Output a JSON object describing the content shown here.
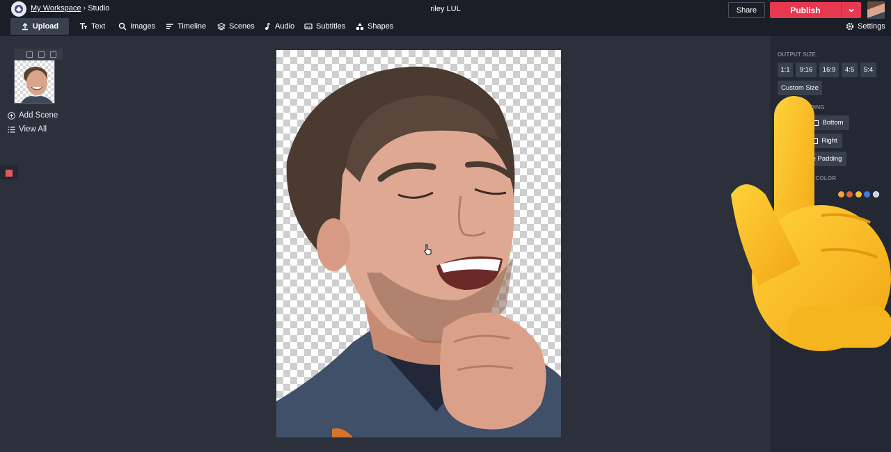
{
  "header": {
    "workspace_link": "My Workspace",
    "breadcrumb_sep": "›",
    "section": "Studio",
    "project_title": "riley LUL",
    "share_label": "Share",
    "publish_label": "Publish"
  },
  "toolbar": {
    "items": [
      {
        "label": "Upload",
        "icon": "upload-icon"
      },
      {
        "label": "Text",
        "icon": "text-icon"
      },
      {
        "label": "Images",
        "icon": "search-icon"
      },
      {
        "label": "Timeline",
        "icon": "timeline-icon"
      },
      {
        "label": "Scenes",
        "icon": "layers-icon"
      },
      {
        "label": "Audio",
        "icon": "music-note-icon"
      },
      {
        "label": "Subtitles",
        "icon": "subtitles-icon"
      },
      {
        "label": "Shapes",
        "icon": "shapes-icon"
      }
    ],
    "settings_label": "Settings"
  },
  "left_panel": {
    "add_scene": "Add Scene",
    "view_all": "View All"
  },
  "right_panel": {
    "output_size_label": "OUTPUT SIZE",
    "ratios": [
      "1:1",
      "9:16",
      "16:9",
      "4:5",
      "5:4"
    ],
    "custom_size": "Custom Size",
    "padding_label": "ADDING",
    "bottom_label": "Bottom",
    "right_label": "Right",
    "remove_padding": "ove Padding",
    "bg_color_label": "ND COLOR",
    "swatch_colors": [
      "#f0a43c",
      "#e8603c",
      "#f2c233",
      "#3c7de8",
      "#c8d0e0"
    ]
  },
  "colors": {
    "accent": "#e63950",
    "topbar_bg": "#1a1e26",
    "panel_bg": "#232832",
    "workspace_bg": "#2b303b"
  }
}
